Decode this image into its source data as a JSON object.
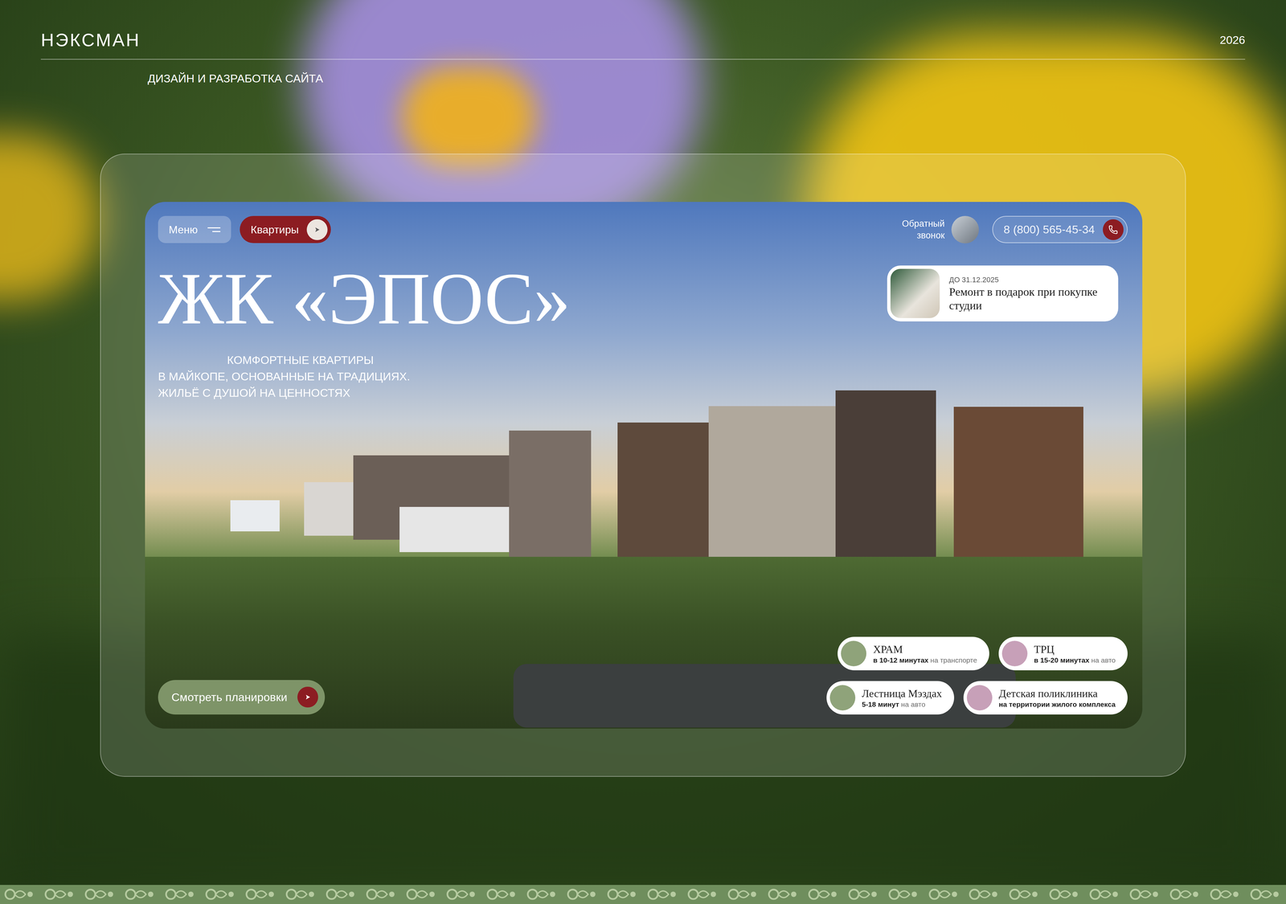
{
  "brand": {
    "logo": "НЭКСМАН",
    "year": "2026",
    "caption": "ДИЗАЙН И РАЗРАБОТКА САЙТА"
  },
  "site": {
    "nav": {
      "menu": "Меню",
      "apartments": "Квартиры",
      "callback": "Обратный звонок",
      "phone": "8 (800) 565-45-34"
    },
    "title": "ЖК «ЭПОС»",
    "subtitle": [
      "КОМФОРТНЫЕ КВАРТИРЫ",
      "В МАЙКОПЕ, ОСНОВАННЫЕ НА ТРАДИЦИЯХ.",
      "ЖИЛЬЁ С ДУШОЙ НА ЦЕННОСТЯХ"
    ],
    "promo": {
      "deadline": "ДО 31.12.2025",
      "text": "Ремонт в подарок при покупке студии"
    },
    "cta": "Смотреть планировки",
    "places": [
      [
        {
          "name": "ХРАМ",
          "time": "в 10-12 минутах",
          "mode": "на транспорте"
        },
        {
          "name": "ТРЦ",
          "time": "в 15-20 минутах",
          "mode": "на авто"
        }
      ],
      [
        {
          "name": "Лестница Мэздах",
          "time": "5-18 минут",
          "mode": "на авто"
        },
        {
          "name": "Детская поликлиника",
          "time": "на территории жилого комплекса"
        }
      ]
    ]
  }
}
